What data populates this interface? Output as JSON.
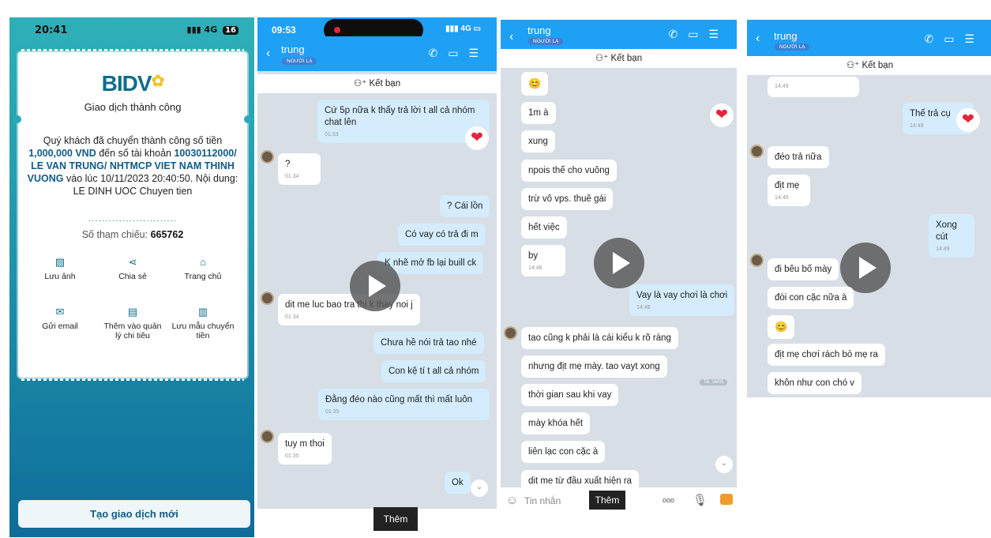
{
  "panel1": {
    "status": {
      "time": "20:41",
      "signal": "4G",
      "battery": "16"
    },
    "bank_logo": "BIDV",
    "title": "Giao dịch thành công",
    "message_prefix": "Quý khách đã chuyển thành công số tiền",
    "amount": "1,000,000 VND",
    "to_account_label": "đến số tài khoản",
    "account": "10030112000/ LE VAN TRUNG/ NHTMCP VIET NAM THINH VUONG",
    "time_label": "vào lúc",
    "datetime": "10/11/2023 20:40:50. Nội dung: LE DINH UOC Chuyen tien",
    "ref_label": "Số tham chiếu:",
    "ref_value": "665762",
    "actions": [
      "Lưu ảnh",
      "Chia sẻ",
      "Trang chủ",
      "Gửi email",
      "Thêm vào quản lý chi tiêu",
      "Lưu mẫu chuyển tiền"
    ],
    "new_button": "Tạo giao dịch mới"
  },
  "panel2": {
    "status": {
      "time": "09:53",
      "signal": "4G"
    },
    "header": {
      "name": "trung",
      "tag": "NGƯỜI LẠ"
    },
    "add_friend": "Kết bạn",
    "messages": [
      {
        "text": "Cứ 5p nữa k thấy trả lời t all cả nhóm chat lên",
        "time": "01:33"
      },
      {
        "text": "?",
        "time": "01:34"
      },
      {
        "text": "? Cái lồn"
      },
      {
        "text": "Có vay có trả đi m"
      },
      {
        "text": "K nhẽ mở fb lại buill ck"
      },
      {
        "text": "dit me luc bao tra thi k thay noi j",
        "time": "01:34"
      },
      {
        "text": "Chưa hề nói trả tao nhé"
      },
      {
        "text": "Con kệ tí t all cả nhóm"
      },
      {
        "text": "Đằng đéo nào cũng mất thì mất luôn",
        "time": "01:35"
      },
      {
        "text": "tuy m thoi",
        "time": "01:35"
      },
      {
        "text": "Ok"
      }
    ],
    "tooltip": "Thêm"
  },
  "panel3": {
    "header": {
      "name": "trung",
      "tag": "NGƯỜI LẠ"
    },
    "add_friend": "Kết bạn",
    "messages": [
      {
        "text": "😊"
      },
      {
        "text": "1m à"
      },
      {
        "text": "xung"
      },
      {
        "text": "npois thế cho vuông"
      },
      {
        "text": "trừ vô vps. thuê gái"
      },
      {
        "text": "hết việc"
      },
      {
        "text": "by",
        "time": "14:48"
      },
      {
        "text": "Vay là vay chơi là chơi",
        "time": "14:48"
      },
      {
        "text": "tao cũng k phải là cái kiểu k rõ ràng"
      },
      {
        "text": "nhưng địt mẹ mày. tao vayt xong"
      },
      {
        "text": "thời gian sau khi vay"
      },
      {
        "text": "mày khóa hết"
      },
      {
        "text": "liên lạc con cặc à"
      },
      {
        "text": "dit me từ đầu xuất hiện ra"
      }
    ],
    "date_chip": "T6, 16/05",
    "input_placeholder": "Tin nhắn",
    "tooltip": "Thêm",
    "more_icon_text": "ooo"
  },
  "panel4": {
    "header": {
      "name": "trung",
      "tag": "NGƯỜI LẠ"
    },
    "add_friend": "Kết bạn",
    "messages": [
      {
        "time": "14:49"
      },
      {
        "text": "Thế trả cụ",
        "time": "14:49"
      },
      {
        "text": "đéo trả nữa"
      },
      {
        "text": "địt mẹ",
        "time": "14:49"
      },
      {
        "text": "Xong cút",
        "time": "14:49"
      },
      {
        "text": "đi bêu bố mày"
      },
      {
        "text": "đòi con cặc nữa à"
      },
      {
        "text": "😊"
      },
      {
        "text": "địt mẹ chơi rách bỏ mẹ ra"
      },
      {
        "text": "khôn như con chó v"
      }
    ]
  },
  "colors": {
    "zalo_blue": "#1ea0f5",
    "bidv_teal": "#0f6d8c",
    "bubble_me": "#d4ecfd",
    "heart": "#e4243a"
  }
}
